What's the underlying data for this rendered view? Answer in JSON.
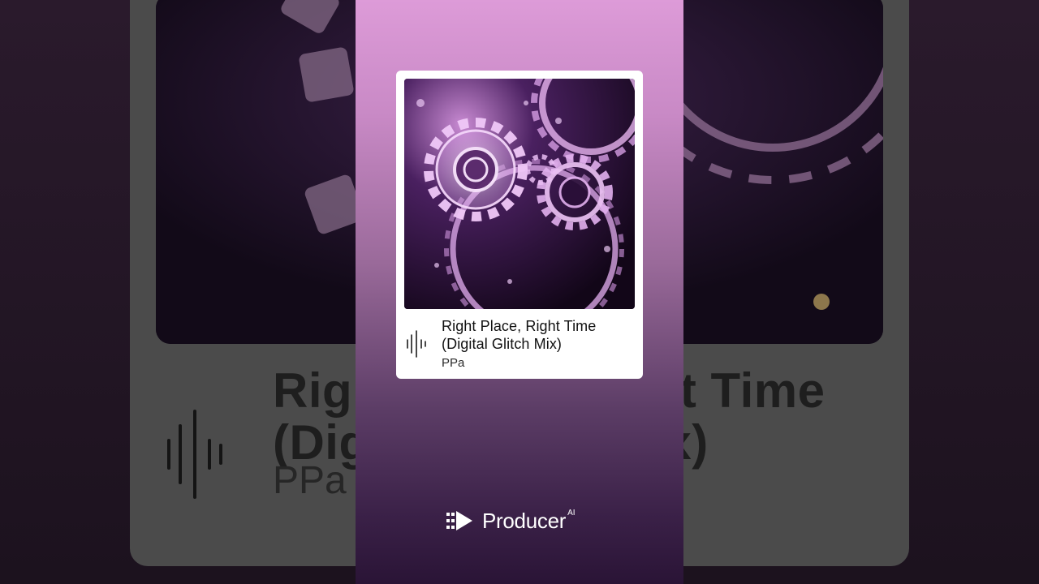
{
  "track": {
    "title_line1": "Right Place, Right Time",
    "title_line2": "(Digital Glitch Mix)",
    "artist": "PPa"
  },
  "background": {
    "title_line1": "Right Place, Right Time",
    "title_line2": "(Digital Glitch Mix)",
    "artist": "PPa"
  },
  "brand": {
    "name": "Producer",
    "superscript": "AI",
    "logo_icon": "play-stack-icon"
  },
  "icons": {
    "waveform": "waveform-icon"
  },
  "colors": {
    "panel_top": "#dd9bd8",
    "panel_bottom": "#2a1436",
    "card_bg": "#ffffff",
    "gear_glow": "#e6b3ee"
  }
}
